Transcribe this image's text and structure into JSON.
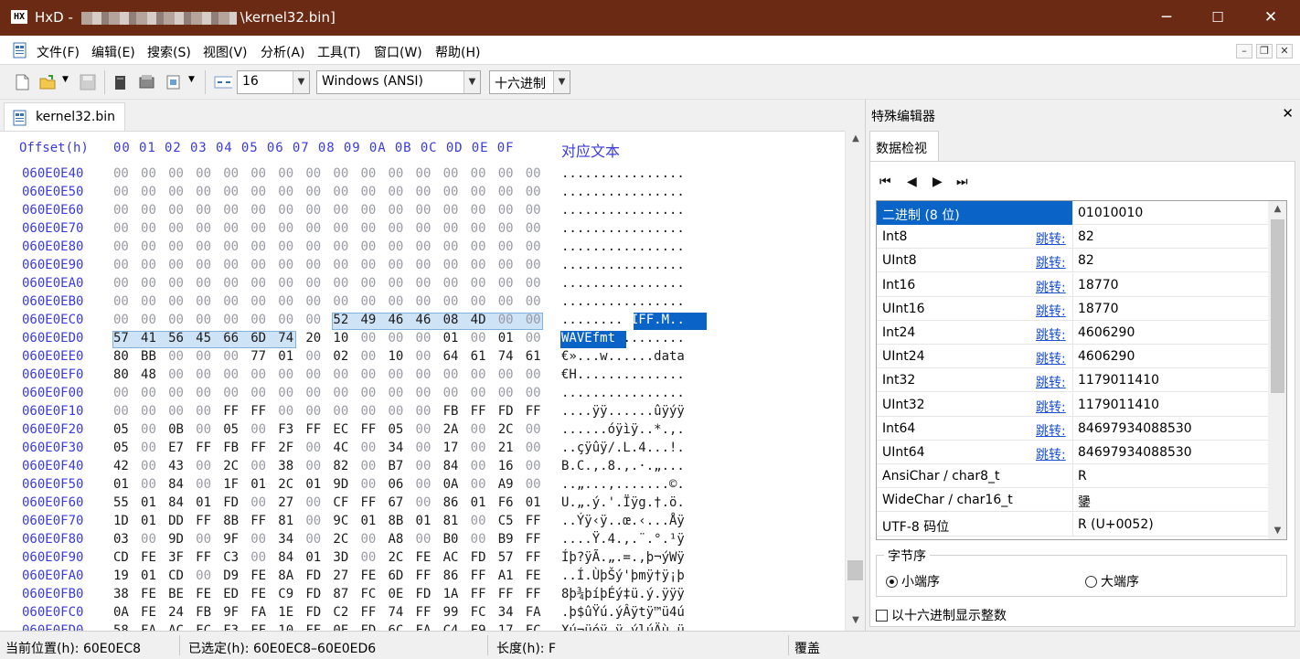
{
  "window": {
    "title_prefix": "HxD - ",
    "title_suffix": "\\kernel32.bin]",
    "minimize_glyph": "─",
    "maximize_glyph": "☐",
    "close_glyph": "✕",
    "app_icon_text": "HX"
  },
  "menubar": {
    "items": [
      "文件(F)",
      "编辑(E)",
      "搜索(S)",
      "视图(V)",
      "分析(A)",
      "工具(T)",
      "窗口(W)",
      "帮助(H)"
    ],
    "mdi_buttons": [
      "–",
      "❐",
      "✕"
    ]
  },
  "toolbar": {
    "bytes_per_row": "16",
    "charset": "Windows (ANSI)",
    "offset_base": "十六进制",
    "dropdown_arrow": "▼"
  },
  "document_tab": {
    "label": "kernel32.bin"
  },
  "hex_view": {
    "header_offset": "Offset(h)",
    "header_columns": "00 01 02 03 04 05 06 07 08 09 0A 0B 0C 0D 0E 0F",
    "header_text": "对应文本",
    "rows": [
      {
        "offset": "060E0E40",
        "bytes": "00 00 00 00 00 00 00 00 00 00 00 00 00 00 00 00",
        "text": "................"
      },
      {
        "offset": "060E0E50",
        "bytes": "00 00 00 00 00 00 00 00 00 00 00 00 00 00 00 00",
        "text": "................"
      },
      {
        "offset": "060E0E60",
        "bytes": "00 00 00 00 00 00 00 00 00 00 00 00 00 00 00 00",
        "text": "................"
      },
      {
        "offset": "060E0E70",
        "bytes": "00 00 00 00 00 00 00 00 00 00 00 00 00 00 00 00",
        "text": "................"
      },
      {
        "offset": "060E0E80",
        "bytes": "00 00 00 00 00 00 00 00 00 00 00 00 00 00 00 00",
        "text": "................"
      },
      {
        "offset": "060E0E90",
        "bytes": "00 00 00 00 00 00 00 00 00 00 00 00 00 00 00 00",
        "text": "................"
      },
      {
        "offset": "060E0EA0",
        "bytes": "00 00 00 00 00 00 00 00 00 00 00 00 00 00 00 00",
        "text": "................"
      },
      {
        "offset": "060E0EB0",
        "bytes": "00 00 00 00 00 00 00 00 00 00 00 00 00 00 00 00",
        "text": "................"
      },
      {
        "offset": "060E0EC0",
        "bytes": "00 00 00 00 00 00 00 00 52 49 46 46 08 4D 00 00",
        "text": "........RIFF.M.."
      },
      {
        "offset": "060E0ED0",
        "bytes": "57 41 56 45 66 6D 74 20 10 00 00 00 01 00 01 00",
        "text": "WAVEfmt ........"
      },
      {
        "offset": "060E0EE0",
        "bytes": "80 BB 00 00 00 77 01 00 02 00 10 00 64 61 74 61",
        "text": "€»...w......data"
      },
      {
        "offset": "060E0EF0",
        "bytes": "80 48 00 00 00 00 00 00 00 00 00 00 00 00 00 00",
        "text": "€H.............."
      },
      {
        "offset": "060E0F00",
        "bytes": "00 00 00 00 00 00 00 00 00 00 00 00 00 00 00 00",
        "text": "................"
      },
      {
        "offset": "060E0F10",
        "bytes": "00 00 00 00 FF FF 00 00 00 00 00 00 FB FF FD FF",
        "text": "....ÿÿ......ûÿýÿ"
      },
      {
        "offset": "060E0F20",
        "bytes": "05 00 0B 00 05 00 F3 FF EC FF 05 00 2A 00 2C 00",
        "text": "......óÿìÿ..*.,."
      },
      {
        "offset": "060E0F30",
        "bytes": "05 00 E7 FF FB FF 2F 00 4C 00 34 00 17 00 21 00",
        "text": "..çÿûÿ/.L.4...!."
      },
      {
        "offset": "060E0F40",
        "bytes": "42 00 43 00 2C 00 38 00 82 00 B7 00 84 00 16 00",
        "text": "B.C.,.8.‚.·.„..."
      },
      {
        "offset": "060E0F50",
        "bytes": "01 00 84 00 1F 01 2C 01 9D 00 06 00 0A 00 A9 00",
        "text": "..„...,.......©."
      },
      {
        "offset": "060E0F60",
        "bytes": "55 01 84 01 FD 00 27 00 CF FF 67 00 86 01 F6 01",
        "text": "U.„.ý.'.Ïÿg.†.ö."
      },
      {
        "offset": "060E0F70",
        "bytes": "1D 01 DD FF 8B FF 81 00 9C 01 8B 01 81 00 C5 FF",
        "text": "..Ýÿ‹ÿ..œ.‹...Åÿ"
      },
      {
        "offset": "060E0F80",
        "bytes": "03 00 9D 00 9F 00 34 00 2C 00 A8 00 B0 00 B9 FF",
        "text": "....Ÿ.4.,.¨.°.¹ÿ"
      },
      {
        "offset": "060E0F90",
        "bytes": "CD FE 3F FF C3 00 84 01 3D 00 2C FE AC FD 57 FF",
        "text": "Íþ?ÿÃ.„.=.,þ¬ýWÿ"
      },
      {
        "offset": "060E0FA0",
        "bytes": "19 01 CD 00 D9 FE 8A FD 27 FE 6D FF 86 FF A1 FE",
        "text": "..Í.ÙþŠý'þmÿ†ÿ¡þ"
      },
      {
        "offset": "060E0FB0",
        "bytes": "38 FE BE FE ED FE C9 FD 87 FC 0E FD 1A FF FF FF",
        "text": "8þ¾þíþÉý‡ü.ý.ÿÿÿ"
      },
      {
        "offset": "060E0FC0",
        "bytes": "0A FE 24 FB 9F FA 1E FD C2 FF 74 FF 99 FC 34 FA",
        "text": ".þ$ûŸú.ýÂÿtÿ™ü4ú"
      },
      {
        "offset": "060E0FD0",
        "bytes": "58 FA AC FC F3 FF 10 FF 0E FD 6C FA C4 F9 17 FC",
        "text": "Xú¬üóÿ.ÿ.ýlúÄù.ü"
      }
    ]
  },
  "special_editor": {
    "panel_title": "特殊编辑器",
    "close_glyph": "✕",
    "tab_label": "数据检视",
    "nav_glyphs": [
      "⏮",
      "◀",
      "▶",
      "⏭"
    ],
    "jump_label": "跳转:",
    "rows": [
      {
        "name": "二进制 (8 位)",
        "value": "01010010",
        "jump": false,
        "selected": true
      },
      {
        "name": "Int8",
        "value": "82",
        "jump": true
      },
      {
        "name": "UInt8",
        "value": "82",
        "jump": true
      },
      {
        "name": "Int16",
        "value": "18770",
        "jump": true
      },
      {
        "name": "UInt16",
        "value": "18770",
        "jump": true
      },
      {
        "name": "Int24",
        "value": "4606290",
        "jump": true
      },
      {
        "name": "UInt24",
        "value": "4606290",
        "jump": true
      },
      {
        "name": "Int32",
        "value": "1179011410",
        "jump": true
      },
      {
        "name": "UInt32",
        "value": "1179011410",
        "jump": true
      },
      {
        "name": "Int64",
        "value": "84697934088530",
        "jump": true
      },
      {
        "name": "UInt64",
        "value": "84697934088530",
        "jump": true
      },
      {
        "name": "AnsiChar / char8_t",
        "value": "R",
        "jump": false
      },
      {
        "name": "WideChar / char16_t",
        "value": "䥒",
        "jump": false
      },
      {
        "name": "UTF-8 码位",
        "value": "R (U+0052)",
        "jump": false
      }
    ],
    "byte_order_title": "字节序",
    "little_endian": "小端序",
    "big_endian": "大端序",
    "byte_order_selected": "little",
    "hex_display_label": "以十六进制显示整数",
    "hex_display_checked": false
  },
  "statusbar": {
    "position": "当前位置(h):  60E0EC8",
    "selection": "已选定(h):  60E0EC8–60E0ED6",
    "length": "长度(h):  F",
    "mode": "覆盖"
  },
  "colors": {
    "titlebar": "#6b2a14",
    "offset_blue": "#3a3ae0",
    "selection_light": "#cfe3f7",
    "selection_dark": "#0a64c8"
  }
}
